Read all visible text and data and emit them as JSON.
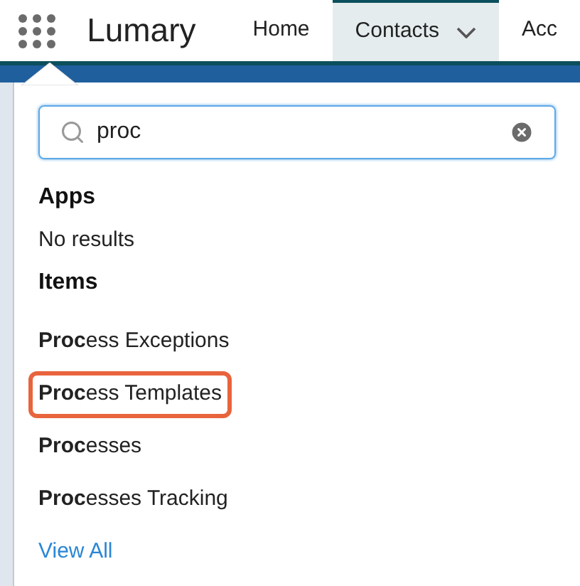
{
  "nav": {
    "app_name": "Lumary",
    "tabs": [
      {
        "label": "Home",
        "selected": false,
        "has_menu": false
      },
      {
        "label": "Contacts",
        "selected": true,
        "has_menu": true
      },
      {
        "label": "Acc",
        "selected": false,
        "has_menu": false
      }
    ]
  },
  "search": {
    "value": "proc"
  },
  "sections": [
    {
      "title": "Apps",
      "empty_text": "No results"
    },
    {
      "title": "Items",
      "items": [
        {
          "label": "**Proc**ess Exceptions",
          "highlighted": false
        },
        {
          "label": "**Proc**ess Templates",
          "highlighted": true
        },
        {
          "label": "**Proc**esses",
          "highlighted": false
        },
        {
          "label": "**Proc**esses Tracking",
          "highlighted": false
        }
      ]
    }
  ],
  "view_all": "View All"
}
